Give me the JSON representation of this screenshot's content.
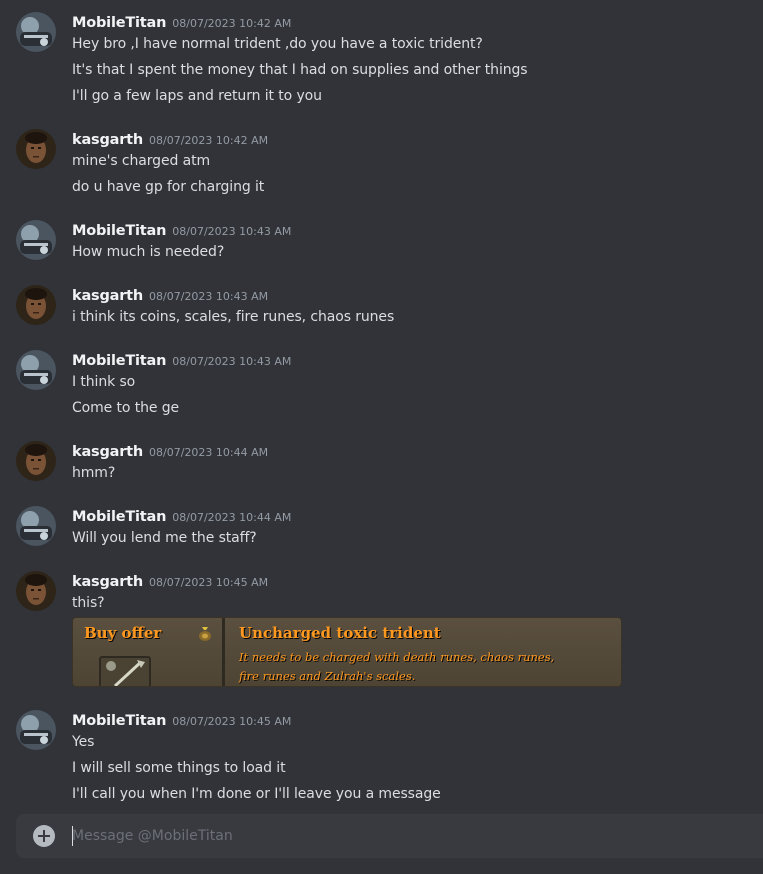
{
  "messages": [
    {
      "author": "MobileTitan",
      "avatar": "mobiletitan-avatar",
      "timestamp": "08/07/2023 10:42 AM",
      "lines": [
        "Hey bro ,I have normal trident ,do you have a toxic trident?",
        "It's that I spent the money that I had on supplies and other things",
        "I'll go a few laps and return it to you"
      ]
    },
    {
      "author": "kasgarth",
      "avatar": "kasgarth-avatar",
      "timestamp": "08/07/2023 10:42 AM",
      "lines": [
        "mine's charged atm",
        "do u have gp for charging it"
      ]
    },
    {
      "author": "MobileTitan",
      "avatar": "mobiletitan-avatar",
      "timestamp": "08/07/2023 10:43 AM",
      "lines": [
        "How much is needed?"
      ]
    },
    {
      "author": "kasgarth",
      "avatar": "kasgarth-avatar",
      "timestamp": "08/07/2023 10:43 AM",
      "lines": [
        "i think its coins, scales, fire runes, chaos runes"
      ]
    },
    {
      "author": "MobileTitan",
      "avatar": "mobiletitan-avatar",
      "timestamp": "08/07/2023 10:43 AM",
      "lines": [
        "I think so",
        "Come to the ge"
      ]
    },
    {
      "author": "kasgarth",
      "avatar": "kasgarth-avatar",
      "timestamp": "08/07/2023 10:44 AM",
      "lines": [
        "hmm?"
      ]
    },
    {
      "author": "MobileTitan",
      "avatar": "mobiletitan-avatar",
      "timestamp": "08/07/2023 10:44 AM",
      "lines": [
        "Will you lend me the staff?"
      ]
    },
    {
      "author": "kasgarth",
      "avatar": "kasgarth-avatar",
      "timestamp": "08/07/2023 10:45 AM",
      "lines": [
        "this?"
      ],
      "attachment": {
        "heading": "Buy offer",
        "item_name": "Uncharged toxic trident",
        "description_lines": [
          "It needs to be charged with death runes, chaos runes,",
          "fire runes and Zulrah's scales."
        ]
      }
    },
    {
      "author": "MobileTitan",
      "avatar": "mobiletitan-avatar",
      "timestamp": "08/07/2023 10:45 AM",
      "lines": [
        "Yes",
        "I will sell some things to load it",
        "I'll call you when I'm done or I'll leave you a message"
      ]
    }
  ],
  "composer": {
    "placeholder": "Message @MobileTitan",
    "value": "",
    "add_icon": "plus-circle-icon"
  },
  "colors": {
    "background": "#313338",
    "username": "#f2f3f5",
    "timestamp": "#949ba4",
    "text": "#dbdee1",
    "embed_text": "#ff981f"
  }
}
